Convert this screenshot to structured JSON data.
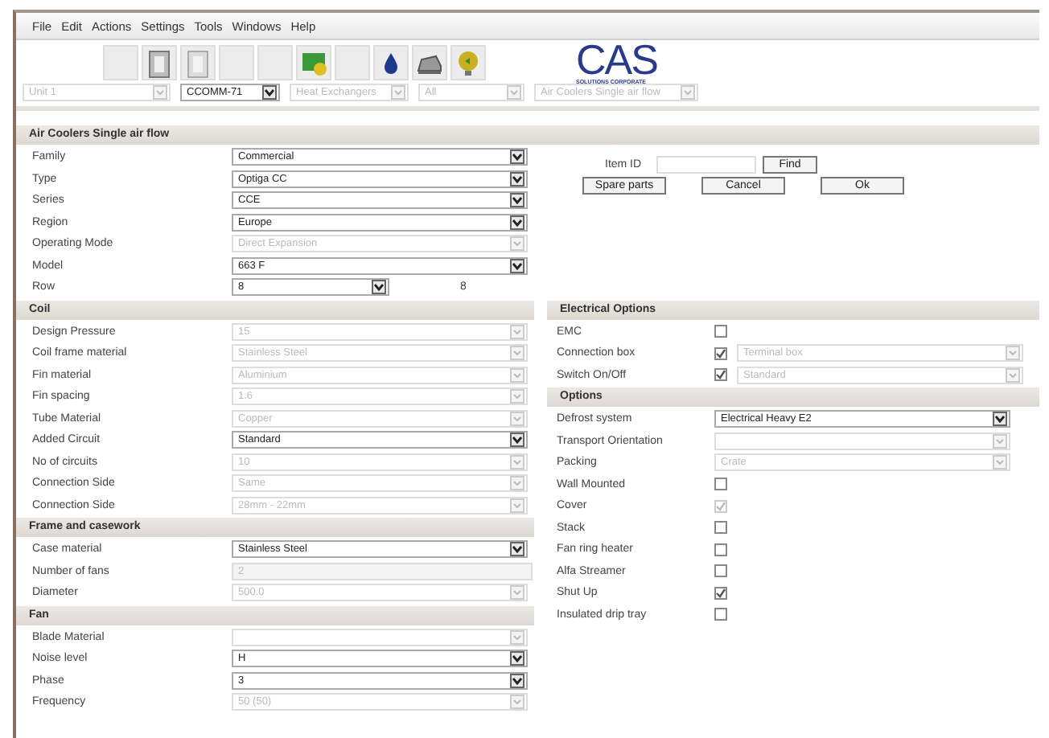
{
  "menu": [
    "File",
    "Edit",
    "Actions",
    "Settings",
    "Tools",
    "Windows",
    "Help"
  ],
  "toolbar_combos": [
    {
      "value": "Unit 1",
      "disabled": true
    },
    {
      "value": "CCOMM-71",
      "disabled": false
    },
    {
      "value": "Heat Exchangers",
      "disabled": true
    },
    {
      "value": "All",
      "disabled": true
    },
    {
      "value": "Air Coolers Single air flow",
      "disabled": true
    }
  ],
  "logo": {
    "text": "CAS",
    "subtitle": "SOLUTIONS CORPORATE"
  },
  "title": "Air Coolers Single air flow",
  "item_panel": {
    "label": "Item ID",
    "buttons": [
      "Find",
      "Spare parts",
      "Cancel",
      "Ok"
    ]
  },
  "left_sections": [
    {
      "rows": [
        {
          "label": "Family",
          "kind": "combo",
          "value": "Commercial",
          "disabled": false
        },
        {
          "label": "Type",
          "kind": "combo",
          "value": "Optiga CC",
          "disabled": false
        },
        {
          "label": "Series",
          "kind": "combo",
          "value": "CCE",
          "disabled": false
        },
        {
          "label": "Region",
          "kind": "combo",
          "value": "Europe",
          "disabled": false
        },
        {
          "label": "Operating Mode",
          "kind": "combo",
          "value": "Direct Expansion",
          "disabled": true
        },
        {
          "label": "Model",
          "kind": "combo",
          "value": "663 F",
          "disabled": false
        },
        {
          "label": "Row",
          "kind": "combo_extra",
          "value": "8",
          "extra": "8",
          "disabled": false
        }
      ]
    },
    {
      "title": "Coil",
      "rows": [
        {
          "label": "Design Pressure",
          "kind": "combo",
          "value": "15",
          "disabled": true
        },
        {
          "label": "Coil frame material",
          "kind": "combo",
          "value": "Stainless Steel",
          "disabled": true
        },
        {
          "label": "Fin material",
          "kind": "combo",
          "value": "Aluminium",
          "disabled": true
        },
        {
          "label": "Fin spacing",
          "kind": "combo",
          "value": "1.6",
          "disabled": true
        },
        {
          "label": "Tube Material",
          "kind": "combo",
          "value": "Copper",
          "disabled": true
        },
        {
          "label": "Added Circuit",
          "kind": "combo",
          "value": "Standard",
          "disabled": false
        },
        {
          "label": "No of circuits",
          "kind": "combo",
          "value": "10",
          "disabled": true
        },
        {
          "label": "Connection Side",
          "kind": "combo",
          "value": "Same",
          "disabled": true
        },
        {
          "label": "Connection Side",
          "kind": "combo",
          "value": "28mm - 22mm",
          "disabled": true
        }
      ]
    },
    {
      "title": "Frame and casework",
      "rows": [
        {
          "label": "Case material",
          "kind": "combo",
          "value": "Stainless Steel",
          "disabled": false
        },
        {
          "label": "Number of fans",
          "kind": "text",
          "value": "2",
          "disabled": true
        },
        {
          "label": "Diameter",
          "kind": "combo",
          "value": "500.0",
          "disabled": true
        }
      ]
    },
    {
      "title": "Fan",
      "rows": [
        {
          "label": "Blade Material",
          "kind": "combo",
          "value": "",
          "disabled": true
        },
        {
          "label": "Noise level",
          "kind": "combo",
          "value": "H",
          "disabled": false
        },
        {
          "label": "Phase",
          "kind": "combo",
          "value": "3",
          "disabled": false
        },
        {
          "label": "Frequency",
          "kind": "combo",
          "value": "50 (50)",
          "disabled": true
        }
      ]
    }
  ],
  "right_sections": [
    {
      "title": "Electrical Options",
      "rows": [
        {
          "label": "EMC",
          "kind": "check",
          "checked": false,
          "disabled": false
        },
        {
          "label": "Connection box",
          "kind": "check_combo",
          "checked": true,
          "disabled": false,
          "value": "Terminal box"
        },
        {
          "label": "Switch On/Off",
          "kind": "check_combo",
          "checked": true,
          "disabled": false,
          "value": "Standard"
        }
      ]
    },
    {
      "title": "Options",
      "rows": [
        {
          "label": "Defrost system",
          "kind": "combo",
          "value": "Electrical Heavy E2",
          "disabled": false
        },
        {
          "label": "Transport Orientation",
          "kind": "combo",
          "value": "",
          "disabled": true
        },
        {
          "label": "Packing",
          "kind": "combo",
          "value": "Crate",
          "disabled": true
        },
        {
          "label": "Wall Mounted",
          "kind": "check",
          "checked": false,
          "disabled": false
        },
        {
          "label": "Cover",
          "kind": "check",
          "checked": true,
          "disabled": true
        },
        {
          "label": "Stack",
          "kind": "check",
          "checked": false,
          "disabled": false
        },
        {
          "label": "Fan ring heater",
          "kind": "check",
          "checked": false,
          "disabled": false
        },
        {
          "label": "Alfa Streamer",
          "kind": "check",
          "checked": false,
          "disabled": false
        },
        {
          "label": "Shut Up",
          "kind": "check",
          "checked": true,
          "disabled": false
        },
        {
          "label": "Insulated drip tray",
          "kind": "check",
          "checked": false,
          "disabled": false
        }
      ]
    }
  ]
}
